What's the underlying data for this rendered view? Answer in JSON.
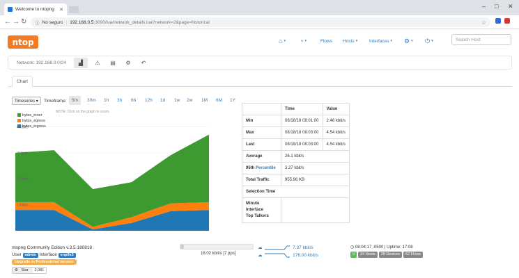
{
  "browser": {
    "tab_title": "Welcome to ntopng",
    "security_label": "No seguro",
    "url_host": "192.168.0.5",
    "url_rest": ":3000/lua/network_details.lua?network=2&page=historical"
  },
  "nav": {
    "logo": "ntop",
    "flows": "Flows",
    "hosts": "Hosts",
    "interfaces": "Interfaces",
    "search_placeholder": "Search Host"
  },
  "network_bar": {
    "label": "Network: 192.168.0.0/24"
  },
  "tabs": {
    "chart": "Chart"
  },
  "timeframe": {
    "timeseries_label": "Timeseries",
    "label": "Timeframe:",
    "options": [
      "5m",
      "30m",
      "1h",
      "3h",
      "6h",
      "12h",
      "1d",
      "1w",
      "2w",
      "1M",
      "6M",
      "1Y"
    ],
    "active": "5m"
  },
  "chart_note": "NOTE: Click on the graph to zoom.",
  "colors": {
    "inner": "#3c9a30",
    "egress": "#ff7f0e",
    "ingress": "#1f77b4",
    "accent": "#337ab7",
    "logo": "#f47b20"
  },
  "chart_data": {
    "type": "area",
    "stacked": true,
    "y_tick_labels": [
      "1 Kbit/s",
      "2 Kbit/s",
      "3 Kbit/s",
      "4 Kbit/s"
    ],
    "y_ticks": [
      1,
      2,
      3,
      4
    ],
    "ylim": [
      0,
      4.6
    ],
    "legend_position": "top-left",
    "x": [
      0,
      1,
      2,
      3,
      4,
      5
    ],
    "series": [
      {
        "name": "bytes_inner",
        "values": [
          1.9,
          2.0,
          1.45,
          1.35,
          1.85,
          2.6
        ]
      },
      {
        "name": "bytes_egress",
        "values": [
          0.3,
          0.3,
          0.1,
          0.22,
          0.3,
          0.3
        ]
      },
      {
        "name": "bytes_ingress",
        "values": [
          0.8,
          0.8,
          0.05,
          0.3,
          0.75,
          0.8
        ]
      }
    ]
  },
  "stats": {
    "headers": [
      "",
      "Time",
      "Value"
    ],
    "rows": [
      {
        "label": "Min",
        "time": "08/18/18 08:01:00",
        "value": "2.48 kbit/s"
      },
      {
        "label": "Max",
        "time": "08/18/18 08:03:00",
        "value": "4.54 kbit/s"
      },
      {
        "label": "Last",
        "time": "08/18/18 08:03:00",
        "value": "4.54 kbit/s"
      }
    ],
    "average_label": "Average",
    "average_value": "26.1 kbit/s",
    "percentile_label_a": "95th",
    "percentile_label_b": "Percentile",
    "percentile_value": "3.27 kbit/s",
    "total_label": "Total Traffic",
    "total_value": "955.96 KB",
    "selection_label": "Selection Time",
    "talkers_label_1": "Minute",
    "talkers_label_2": "Interface",
    "talkers_label_3": "Top Talkers"
  },
  "footer": {
    "edition": "ntopng Community Edition v.3.5.180818",
    "user_label": "User",
    "user_badge": "admin",
    "interface_label": "Interface",
    "interface_badge": "enp0s3",
    "upgrade": "Upgrade to Professional version",
    "github_star": "Star",
    "github_count": "2,081",
    "throughput": "16.02 kbit/s [7 pps]",
    "upload": "7.37 kbit/s",
    "download": "176.00 kbit/s",
    "clock": "08:04:17 -0500 | Uptime: 17:08",
    "counters": [
      "9",
      "24 Hosts",
      "28 Devices",
      "52 Flows"
    ]
  }
}
